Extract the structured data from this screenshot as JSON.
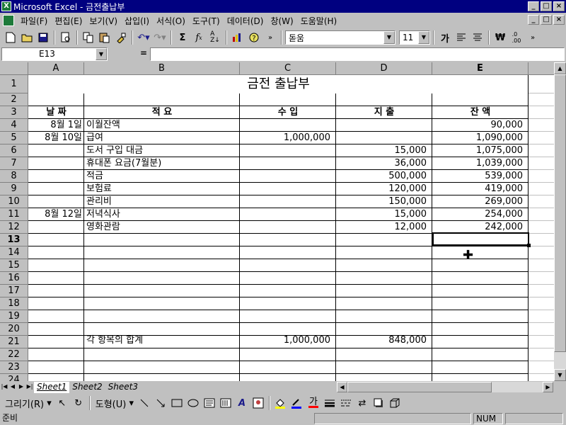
{
  "window": {
    "title": "Microsoft Excel - 금전출납부",
    "min": "_",
    "max": "□",
    "close": "×"
  },
  "menu": [
    "파일(F)",
    "편집(E)",
    "보기(V)",
    "삽입(I)",
    "서식(O)",
    "도구(T)",
    "데이터(D)",
    "창(W)",
    "도움말(H)"
  ],
  "toolbar": {
    "font_name": "돋움",
    "font_size": "11",
    "bold_label": "가"
  },
  "formula_bar": {
    "name_box": "E13",
    "equals": "=",
    "content": ""
  },
  "columns": [
    "A",
    "B",
    "C",
    "D",
    "E"
  ],
  "rows": [
    "1",
    "2",
    "3",
    "4",
    "5",
    "6",
    "7",
    "8",
    "9",
    "10",
    "11",
    "12",
    "13",
    "14",
    "15",
    "16",
    "17",
    "18",
    "19",
    "20",
    "21",
    "22",
    "23",
    "24"
  ],
  "sheet": {
    "title": "금전 출납부",
    "headers": {
      "date": "날    짜",
      "desc": "적          요",
      "income": "수      입",
      "expense": "지      출",
      "balance": "잔      액"
    },
    "entries": [
      {
        "row": 4,
        "date": "8월  1일",
        "desc": "이월잔액",
        "income": "",
        "expense": "",
        "balance": "90,000"
      },
      {
        "row": 5,
        "date": "8월  10일",
        "desc": "급여",
        "income": "1,000,000",
        "expense": "",
        "balance": "1,090,000"
      },
      {
        "row": 6,
        "date": "",
        "desc": "도서 구입 대금",
        "income": "",
        "expense": "15,000",
        "balance": "1,075,000"
      },
      {
        "row": 7,
        "date": "",
        "desc": "휴대폰 요금(7월분)",
        "income": "",
        "expense": "36,000",
        "balance": "1,039,000"
      },
      {
        "row": 8,
        "date": "",
        "desc": "적금",
        "income": "",
        "expense": "500,000",
        "balance": "539,000"
      },
      {
        "row": 9,
        "date": "",
        "desc": "보험료",
        "income": "",
        "expense": "120,000",
        "balance": "419,000"
      },
      {
        "row": 10,
        "date": "",
        "desc": "관리비",
        "income": "",
        "expense": "150,000",
        "balance": "269,000"
      },
      {
        "row": 11,
        "date": "8월  12일",
        "desc": "저녁식사",
        "income": "",
        "expense": "15,000",
        "balance": "254,000"
      },
      {
        "row": 12,
        "date": "",
        "desc": "영화관람",
        "income": "",
        "expense": "12,000",
        "balance": "242,000"
      }
    ],
    "total": {
      "row": 21,
      "desc": "각 항목의 합계",
      "income": "1,000,000",
      "expense": "848,000"
    }
  },
  "selected_cell": {
    "ref": "E13",
    "row": 13,
    "col": "E"
  },
  "sheet_tabs": [
    "Sheet1",
    "Sheet2",
    "Sheet3"
  ],
  "active_sheet": "Sheet1",
  "drawing_toolbar": {
    "draw_label": "그리기(R)",
    "autoshape_label": "도형(U)",
    "font_color_label": "가"
  },
  "status": {
    "left": "준비",
    "num": "NUM"
  }
}
